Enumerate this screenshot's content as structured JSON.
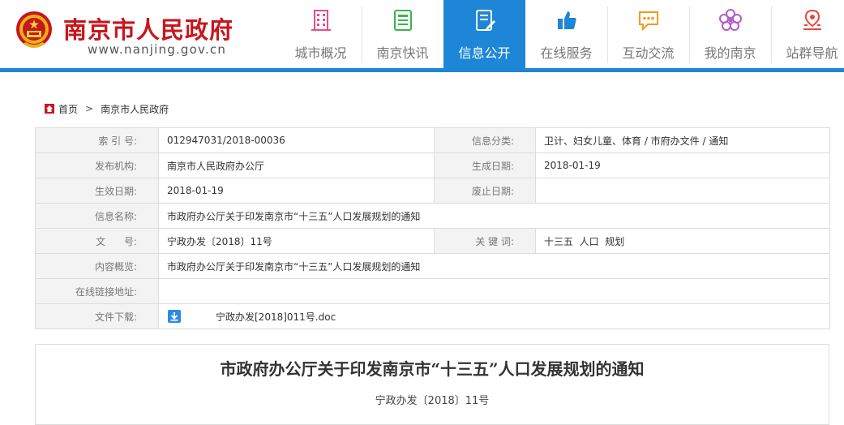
{
  "site": {
    "title": "南京市人民政府",
    "url": "www.nanjing.gov.cn",
    "logo_icon": "national-emblem-icon"
  },
  "nav": {
    "items": [
      {
        "label": "城市概况",
        "icon": "building-icon",
        "color": "#e94c8c"
      },
      {
        "label": "南京快讯",
        "icon": "newspaper-icon",
        "color": "#3ab54a"
      },
      {
        "label": "信息公开",
        "icon": "document-edit-icon",
        "color": "#ffffff"
      },
      {
        "label": "在线服务",
        "icon": "thumbs-up-icon",
        "color": "#1e86d6"
      },
      {
        "label": "互动交流",
        "icon": "chat-bubble-icon",
        "color": "#f39a1f"
      },
      {
        "label": "我的南京",
        "icon": "plum-blossom-icon",
        "color": "#b25bc8"
      },
      {
        "label": "站群导航",
        "icon": "map-pin-icon",
        "color": "#e8463f"
      }
    ],
    "active_index": 2,
    "accent_color": "#1e86d6"
  },
  "breadcrumb": {
    "home": "首页",
    "separator": ">",
    "current": "南京市人民政府"
  },
  "info": {
    "index_label": "索 引 号:",
    "index_value": "012947031/2018-00036",
    "category_label": "信息分类:",
    "category_value": "卫计、妇女儿童、体育 / 市府办文件 / 通知",
    "publisher_label": "发布机构:",
    "publisher_value": "南京市人民政府办公厅",
    "created_label": "生成日期:",
    "created_value": "2018-01-19",
    "effective_label": "生效日期:",
    "effective_value": "2018-01-19",
    "abolished_label": "废止日期:",
    "abolished_value": "",
    "name_label": "信息名称:",
    "name_value": "市政府办公厅关于印发南京市“十三五”人口发展规划的通知",
    "docno_label": "文      号:",
    "docno_value": "宁政办发〔2018〕11号",
    "keywords_label": "关 键 词:",
    "keywords_value": "十三五  人口  规划",
    "summary_label": "内容概览:",
    "summary_value": "市政府办公厅关于印发南京市“十三五”人口发展规划的通知",
    "link_label": "在线链接地址:",
    "link_value": "",
    "download_label": "文件下载:",
    "download_file": "宁政办发[2018]011号.doc"
  },
  "document": {
    "title": "市政府办公厅关于印发南京市“十三五”人口发展规划的通知",
    "number": "宁政办发〔2018〕11号"
  }
}
